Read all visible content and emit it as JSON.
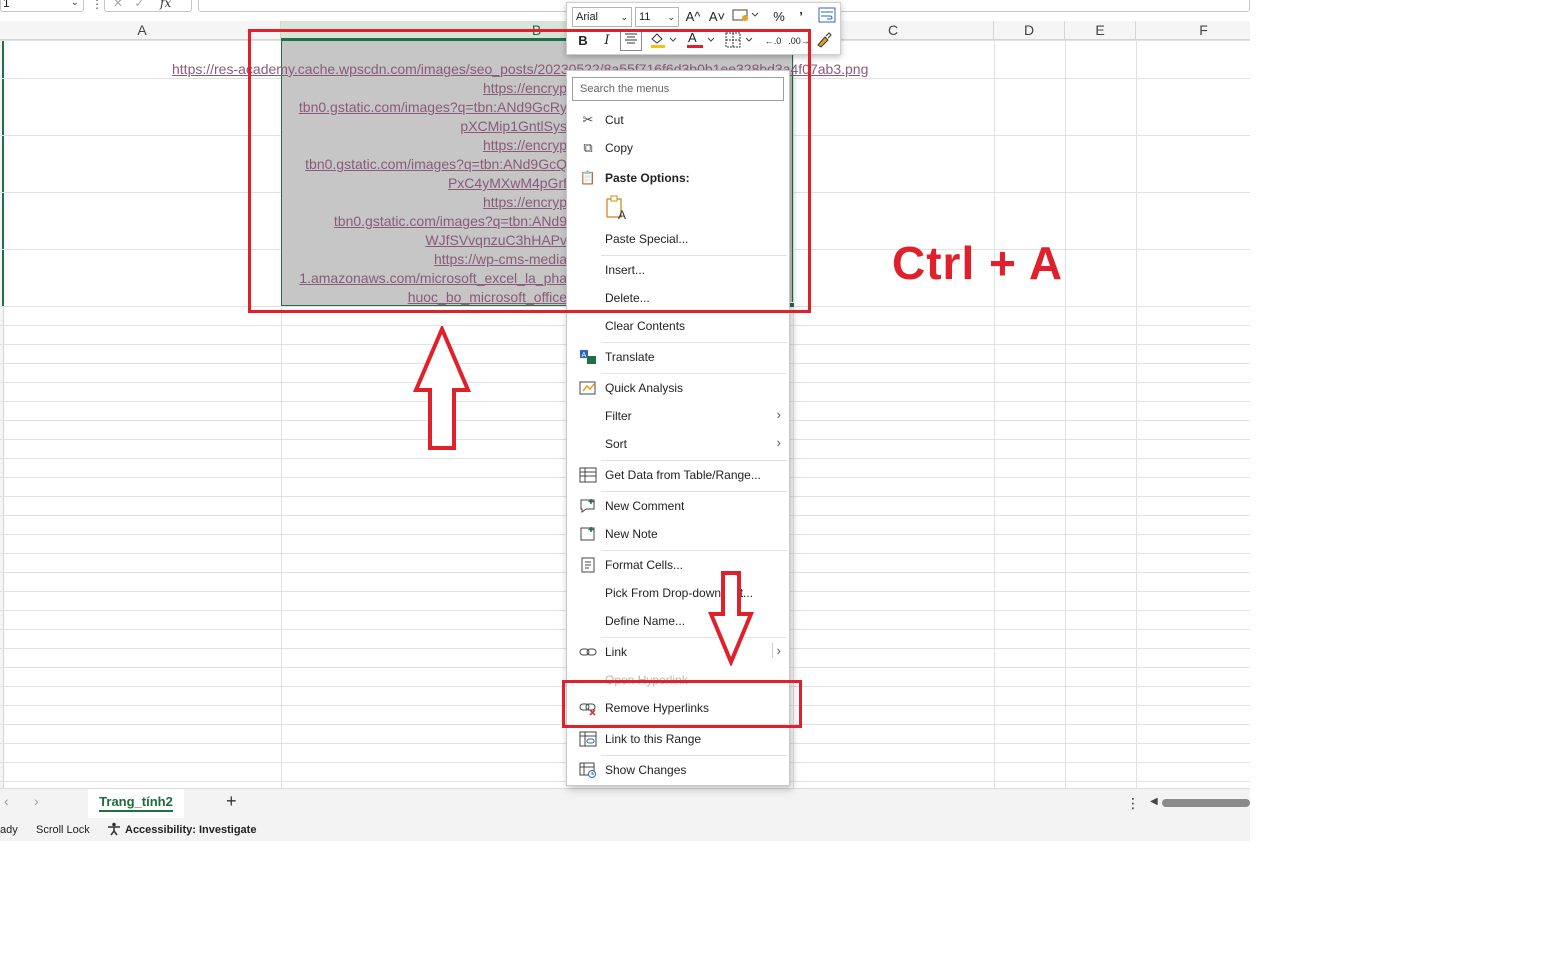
{
  "formula_bar": {
    "name_box_value": "1",
    "fx_label": "fx"
  },
  "columns": [
    {
      "label": "A",
      "selected": false
    },
    {
      "label": "B",
      "selected": true
    },
    {
      "label": "C",
      "selected": false
    },
    {
      "label": "D",
      "selected": false
    },
    {
      "label": "E",
      "selected": false
    },
    {
      "label": "F",
      "selected": false
    }
  ],
  "cells": {
    "link1": "https://res-academy.cache.wpscdn.com/images/seo_posts/20230522/8a55f716f6d3b0b1ee328bd3a4f07ab3.png",
    "link2_l1": "https://encryp",
    "link2_l2": "tbn0.gstatic.com/images?q=tbn:ANd9GcRy",
    "link2_l3": "pXCMip1GntlSys",
    "link3_l1": "https://encryp",
    "link3_l2": "tbn0.gstatic.com/images?q=tbn:ANd9GcQ",
    "link3_l3": "PxC4yMXwM4pGrf",
    "link4_l1": "https://encryp",
    "link4_l2": "tbn0.gstatic.com/images?q=tbn:ANd9",
    "link4_l3": "WJfSVvqnzuC3hHAPv",
    "link5_l1": "https://wp-cms-media",
    "link5_l2": "1.amazonaws.com/microsoft_excel_la_pha",
    "link5_l3": "huoc_bo_microsoft_office"
  },
  "mini_toolbar": {
    "font_name": "Arial",
    "font_size": "11",
    "increase_font": "A^",
    "decrease_font": "A˅",
    "percent": "%",
    "comma": "’",
    "bold": "B",
    "italic": "I",
    "font_color_letter": "A",
    "dec_increase": "←.0",
    "dec_decrease": ".00→",
    "highlight_color": "#f2c314",
    "font_color": "#e0202a"
  },
  "context_menu": {
    "search_placeholder": "Search the menus",
    "items": [
      {
        "label": "Cut",
        "icon": "scissors-icon"
      },
      {
        "label": "Copy",
        "icon": "copy-icon"
      },
      {
        "label": "Paste Options:",
        "icon": "paste-icon"
      },
      {
        "label": "Paste Special..."
      },
      {
        "label": "Insert..."
      },
      {
        "label": "Delete..."
      },
      {
        "label": "Clear Contents"
      },
      {
        "label": "Translate",
        "icon": "translate-icon"
      },
      {
        "label": "Quick Analysis",
        "icon": "quick-analysis-icon"
      },
      {
        "label": "Filter",
        "submenu": true
      },
      {
        "label": "Sort",
        "submenu": true
      },
      {
        "label": "Get Data from Table/Range...",
        "icon": "table-icon"
      },
      {
        "label": "New Comment",
        "icon": "comment-icon"
      },
      {
        "label": "New Note",
        "icon": "note-icon"
      },
      {
        "label": "Format Cells...",
        "icon": "format-cells-icon"
      },
      {
        "label": "Pick From Drop-down List..."
      },
      {
        "label": "Define Name..."
      },
      {
        "label": "Link",
        "icon": "link-icon",
        "submenu": true
      },
      {
        "label": "Open Hyperlink",
        "disabled": true
      },
      {
        "label": "Remove Hyperlinks",
        "icon": "remove-link-icon"
      },
      {
        "label": "Link to this Range",
        "icon": "link-range-icon"
      },
      {
        "label": "Show Changes",
        "icon": "show-changes-icon"
      }
    ]
  },
  "sheet_tabs": {
    "active": "Trang_tính2",
    "add_label": "+"
  },
  "status_bar": {
    "ready": "ady",
    "scroll_lock": "Scroll Lock",
    "accessibility": "Accessibility: Investigate"
  },
  "annotation": {
    "text": "Ctrl + A",
    "color": "#e0202a"
  }
}
